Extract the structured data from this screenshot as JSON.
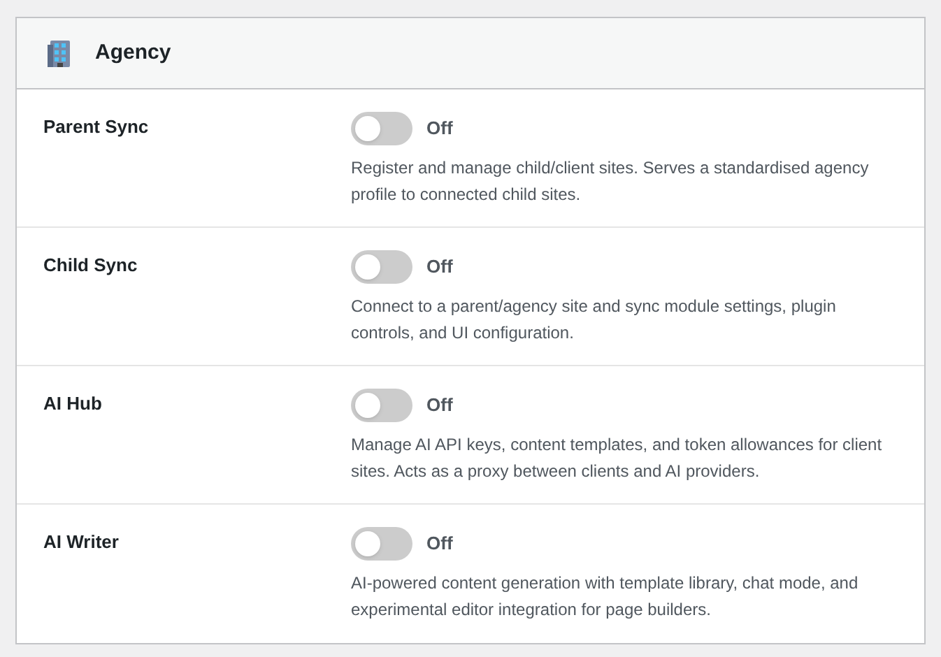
{
  "panel": {
    "title": "Agency"
  },
  "modules": [
    {
      "name": "Parent Sync",
      "on": false,
      "state_label": "Off",
      "description": "Register and manage child/client sites. Serves a standardised agency profile to connected child sites."
    },
    {
      "name": "Child Sync",
      "on": false,
      "state_label": "Off",
      "description": "Connect to a parent/agency site and sync module settings, plugin controls, and UI configuration."
    },
    {
      "name": "AI Hub",
      "on": false,
      "state_label": "Off",
      "description": "Manage AI API keys, content templates, and token allowances for client sites. Acts as a proxy between clients and AI providers."
    },
    {
      "name": "AI Writer",
      "on": false,
      "state_label": "Off",
      "description": "AI-powered content generation with template library, chat mode, and experimental editor integration for page builders."
    }
  ]
}
